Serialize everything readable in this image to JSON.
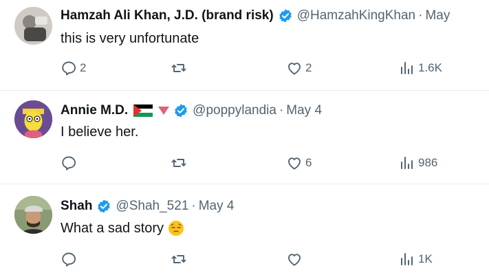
{
  "tweets": [
    {
      "name": "Hamzah Ali Khan, J.D. (brand risk)",
      "handle": "@HamzahKingKhan",
      "date": "May",
      "text": "this is very unfortunate",
      "replies": "2",
      "likes": "2",
      "views": "1.6K"
    },
    {
      "name": "Annie M.D.",
      "handle": "@poppylandia",
      "date": "May 4",
      "text": "I believe her.",
      "replies": "",
      "likes": "6",
      "views": "986"
    },
    {
      "name": "Shah",
      "handle": "@Shah_521",
      "date": "May 4",
      "text": "What a sad story",
      "replies": "",
      "likes": "",
      "views": "1K"
    }
  ],
  "separator": "·",
  "icons": [
    "reply-icon",
    "retweet-icon",
    "like-icon",
    "views-icon",
    "verified-badge-icon"
  ],
  "colors": {
    "verified": "#1d9bf0",
    "muted": "#536471",
    "text": "#0f1419"
  }
}
